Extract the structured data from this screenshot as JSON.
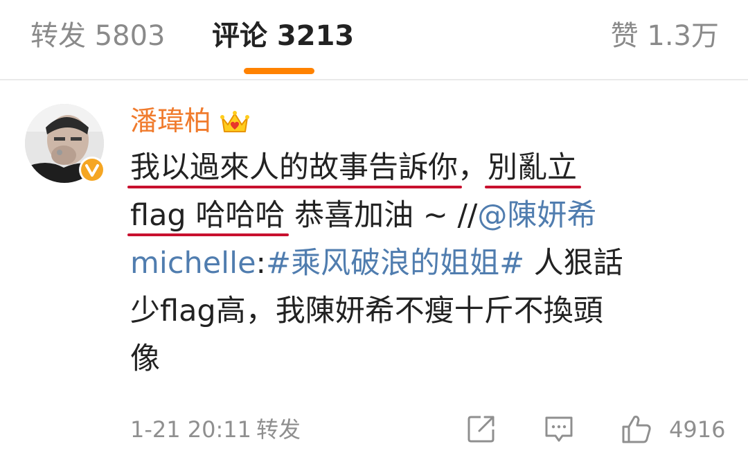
{
  "tabs": {
    "repost": "转发 5803",
    "comments": "评论 3213",
    "likes": "赞 1.3万",
    "active": "comments"
  },
  "comment": {
    "username": "潘瑋柏",
    "username_color": "#f07b2d",
    "badge_icon": "crown-icon",
    "verified_icon": "verified-v-icon",
    "body": {
      "line1_hl1": "我以過來人的故事告訴你",
      "line1_comma": "，",
      "line1_hl2": "別亂立",
      "line2_hl": "flag 哈哈哈",
      "line2_rest": " 恭喜加油 ~ //",
      "mention_part1": "@陳妍希",
      "mention_part2": "michelle",
      "colon": ":",
      "hashtag": "#乘风破浪的姐姐#",
      "line3_rest": " 人狠話",
      "line4": "少flag高，我陳妍希不瘦十斤不換頭",
      "line5": "像"
    },
    "underline_color": "#c8102e",
    "link_color": "#507daf",
    "timestamp": "1-21 20:11",
    "reply_label": "转发",
    "like_count": "4916"
  },
  "accent_color": "#ff8200"
}
